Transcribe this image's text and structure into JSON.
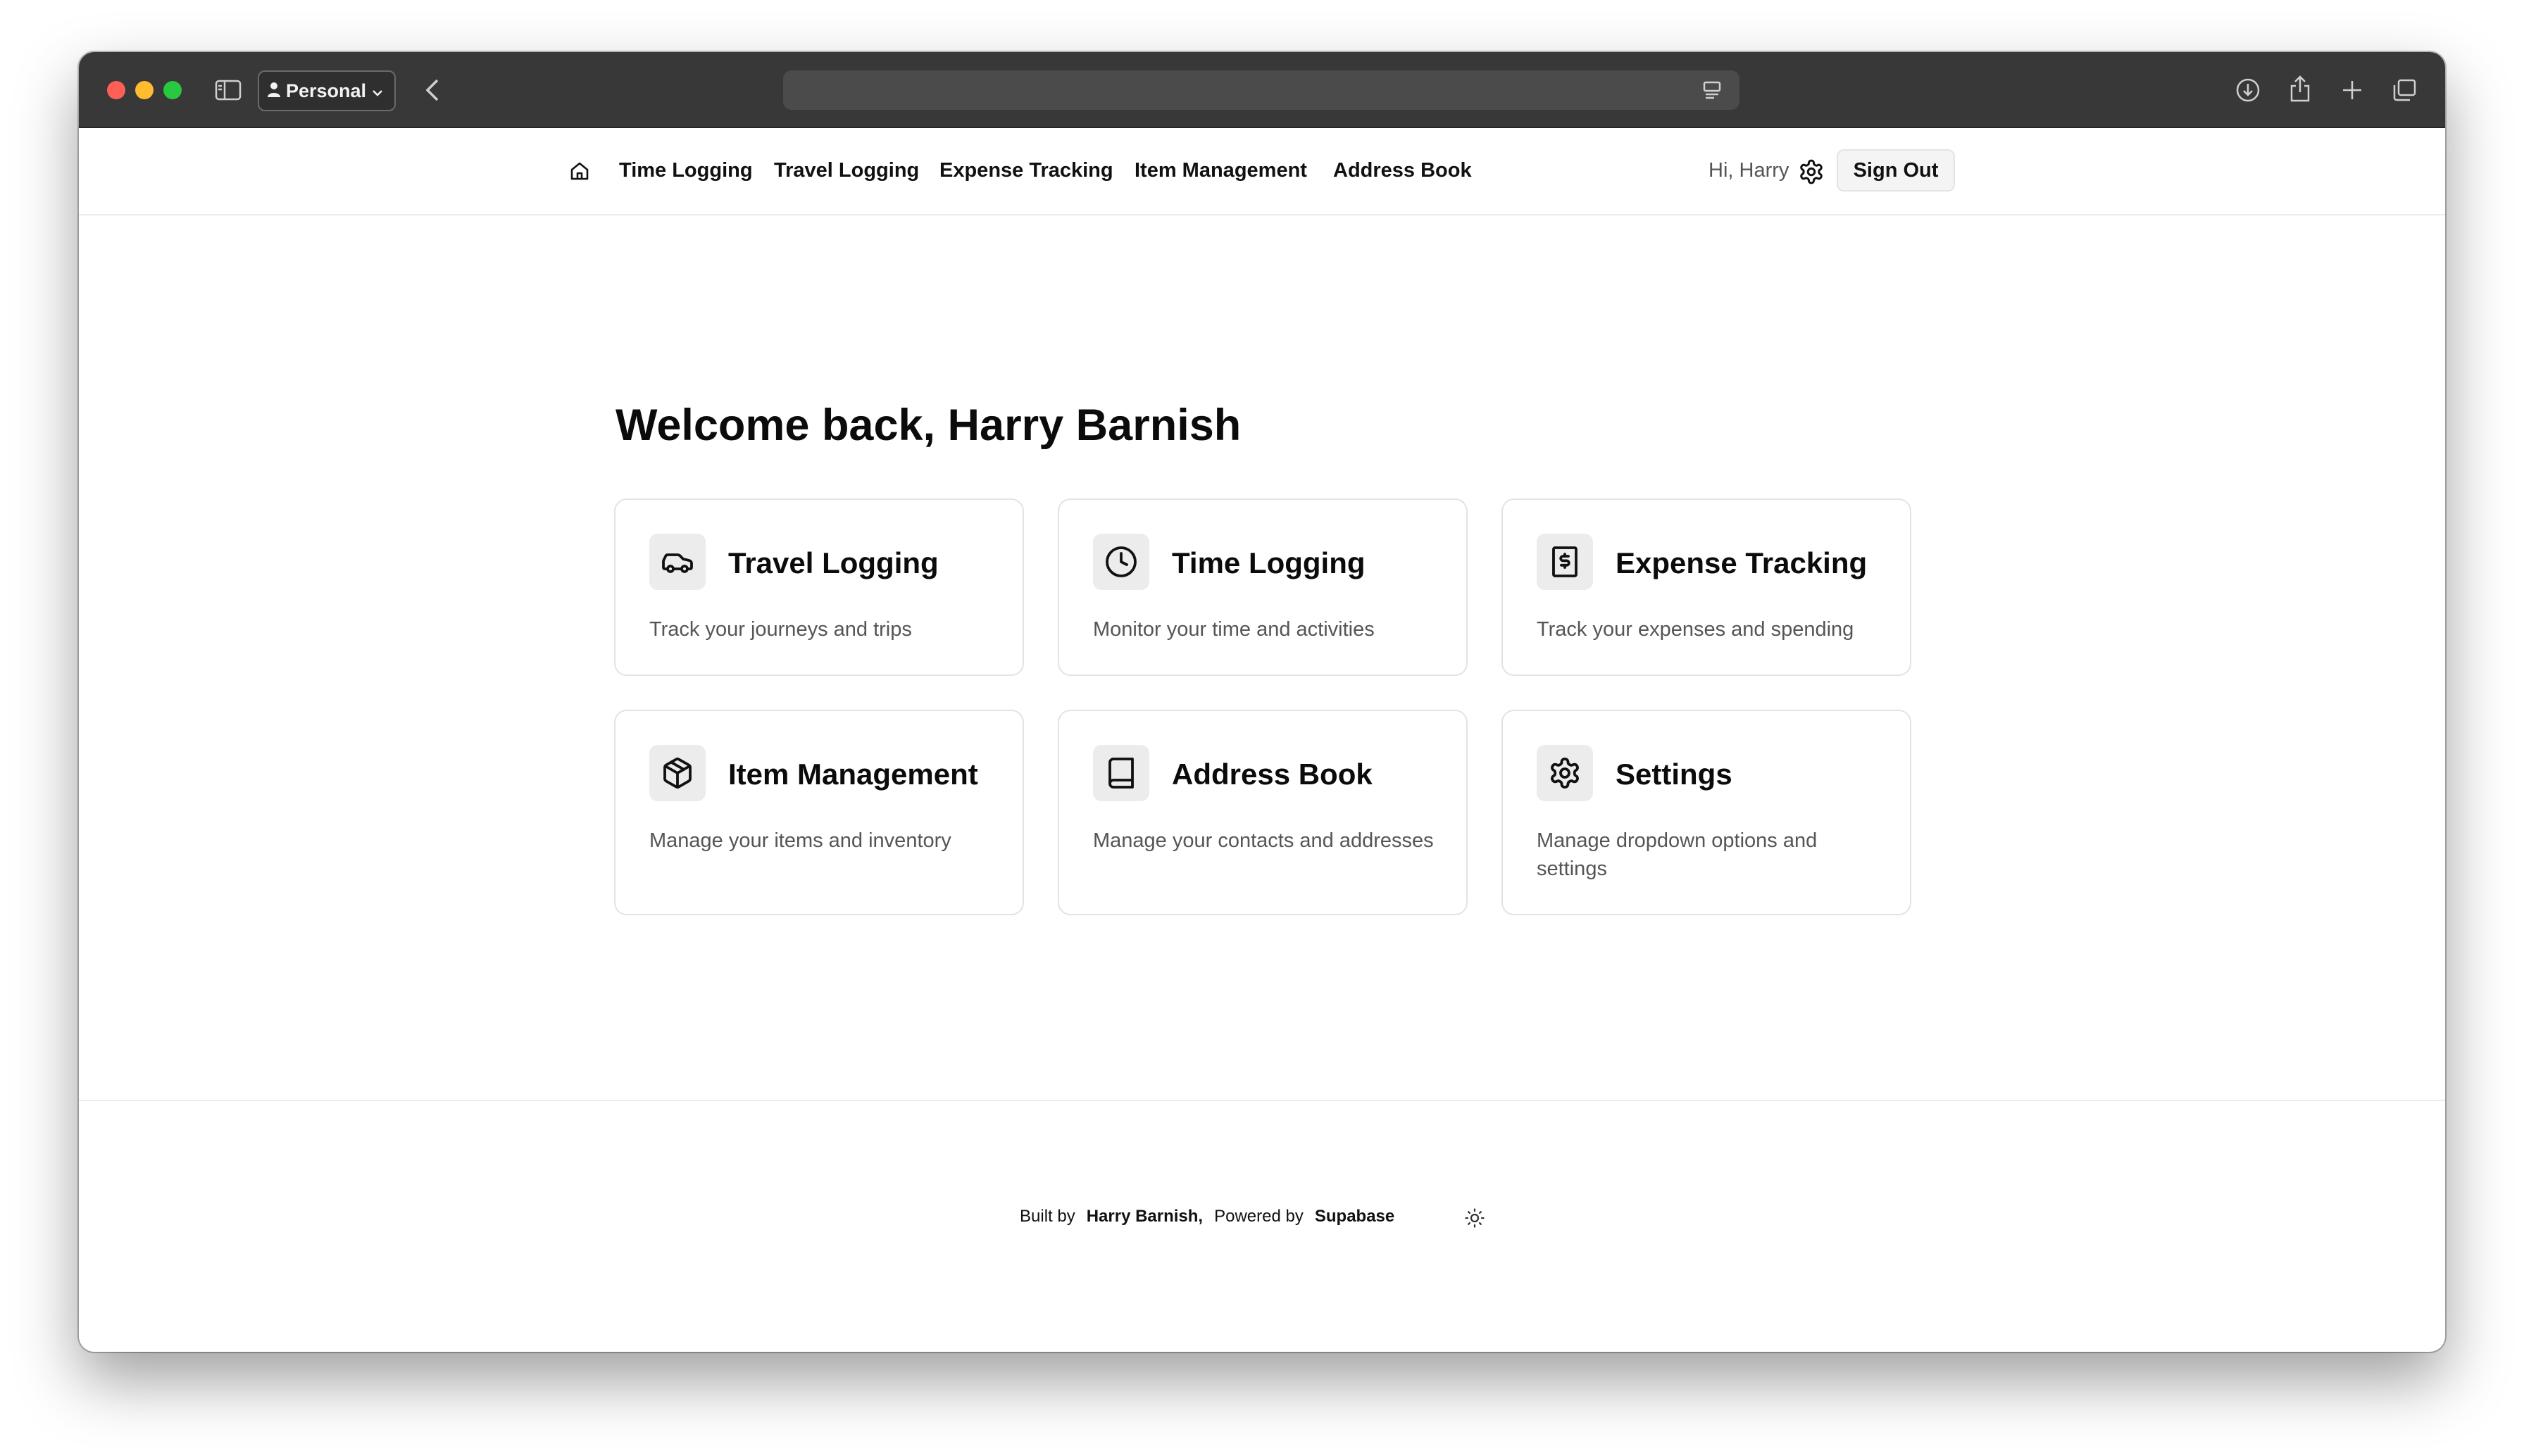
{
  "browser": {
    "profile_label": "Personal",
    "address_text": ""
  },
  "nav": {
    "links": [
      "Time Logging",
      "Travel Logging",
      "Expense Tracking",
      "Item Management",
      "Address Book"
    ],
    "greeting": "Hi, Harry",
    "sign_out": "Sign Out"
  },
  "main": {
    "welcome": "Welcome back, Harry Barnish",
    "cards": [
      {
        "title": "Travel Logging",
        "description": "Track your journeys and trips",
        "icon": "car-icon"
      },
      {
        "title": "Time Logging",
        "description": "Monitor your time and activities",
        "icon": "clock-icon"
      },
      {
        "title": "Expense Tracking",
        "description": "Track your expenses and spending",
        "icon": "receipt-icon"
      },
      {
        "title": "Item Management",
        "description": "Manage your items and inventory",
        "icon": "package-icon"
      },
      {
        "title": "Address Book",
        "description": "Manage your contacts and addresses",
        "icon": "book-icon"
      },
      {
        "title": "Settings",
        "description": "Manage dropdown options and settings",
        "icon": "gear-icon"
      }
    ]
  },
  "footer": {
    "built_by_label": "Built by",
    "built_by_name": "Harry Barnish,",
    "powered_by_label": "Powered by",
    "powered_by_name": "Supabase"
  },
  "colors": {
    "titlebar": "#383838",
    "card_border": "#e3e3e3",
    "icon_bg": "#ececec"
  }
}
